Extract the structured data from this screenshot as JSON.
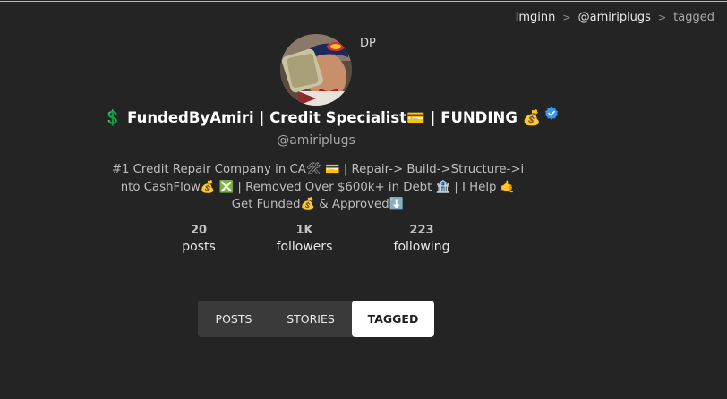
{
  "breadcrumb": {
    "site": "Imginn",
    "separator": ">",
    "user": "@amiriplugs",
    "current": "tagged"
  },
  "profile": {
    "dp_label": "DP",
    "display_name": "💲 FundedByAmiri | Credit Specialist💳  | FUNDING 💰",
    "handle": "@amiriplugs",
    "bio": "#1 Credit Repair Company in CA🛠 💳 | Repair-> Build->Structure->i\nnto CashFlow💰 ❎ | Removed Over $600k+ in Debt 🏦 | I Help 🤙\nGet Funded💰 & Approved⬇️",
    "verified": true
  },
  "stats": {
    "posts": {
      "value": "20",
      "label": "posts"
    },
    "followers": {
      "value": "1K",
      "label": "followers"
    },
    "following": {
      "value": "223",
      "label": "following"
    }
  },
  "tabs": {
    "posts": "POSTS",
    "stories": "STORIES",
    "tagged": "TAGGED",
    "active": "tagged"
  },
  "colors": {
    "background": "#242424",
    "verified": "#3897f0",
    "active_tab": "#ffffff"
  }
}
